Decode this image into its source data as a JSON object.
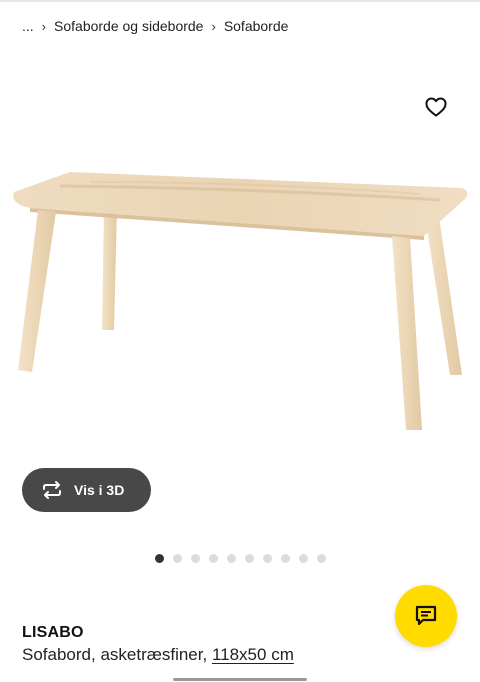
{
  "breadcrumb": {
    "ellipsis": "...",
    "items": [
      {
        "label": "Sofaborde og sideborde"
      },
      {
        "label": "Sofaborde"
      }
    ]
  },
  "gallery": {
    "view_3d_label": "Vis i 3D",
    "dot_count": 10,
    "active_index": 0
  },
  "product": {
    "name": "LISABO",
    "description": "Sofabord, asketræsfiner,",
    "dimensions": "118x50 cm"
  },
  "icons": {
    "favorite": "heart-outline-icon",
    "view_3d": "rotate-3d-icon",
    "chat": "chat-bubble-icon"
  },
  "colors": {
    "accent_yellow": "#ffdb00",
    "pill_dark": "#484848",
    "active_dot": "#333333",
    "inactive_dot": "#dcdcdc"
  }
}
